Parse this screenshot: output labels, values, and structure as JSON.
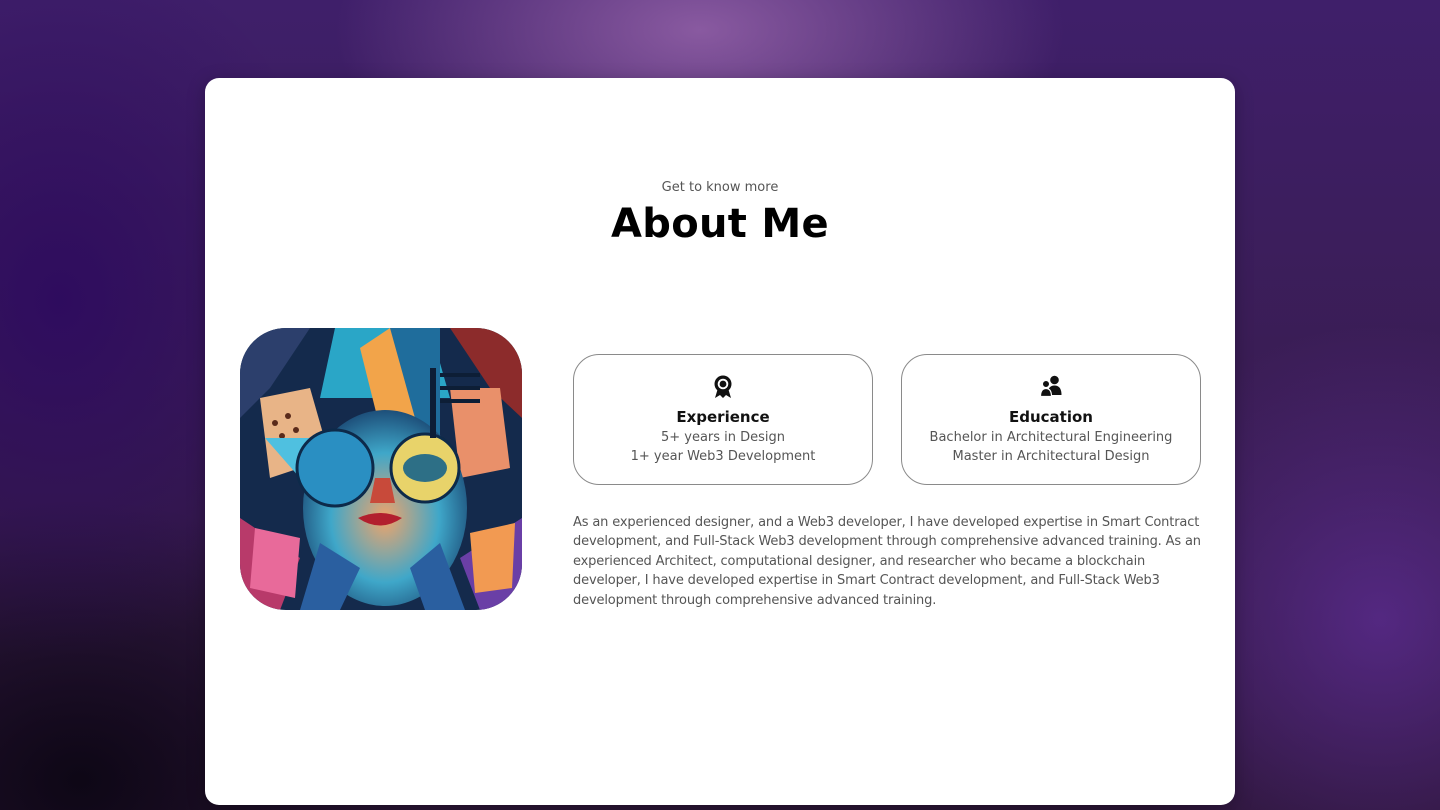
{
  "about": {
    "eyebrow": "Get to know more",
    "title": "About Me",
    "portrait_icon": "abstract-cubist-portrait-image",
    "experience": {
      "icon": "award-medal-icon",
      "heading": "Experience",
      "line1": "5+ years in Design",
      "line2": "1+ year Web3 Development"
    },
    "education": {
      "icon": "users-group-icon",
      "heading": "Education",
      "line1": "Bachelor in Architectural Engineering",
      "line2": "Master in Architectural Design"
    },
    "bio": "As an experienced designer, and a Web3 developer, I have developed expertise in Smart Contract development, and Full-Stack Web3 development through comprehensive advanced training. As an experienced Architect, computational designer, and researcher who became a blockchain developer, I have developed expertise in Smart Contract development, and Full-Stack Web3 development through comprehensive advanced training."
  },
  "colors": {
    "card_background": "#ffffff",
    "heading": "#000000",
    "body_text": "#555555",
    "card_border": "#8a8a8a",
    "page_background": "#3a1d55"
  }
}
